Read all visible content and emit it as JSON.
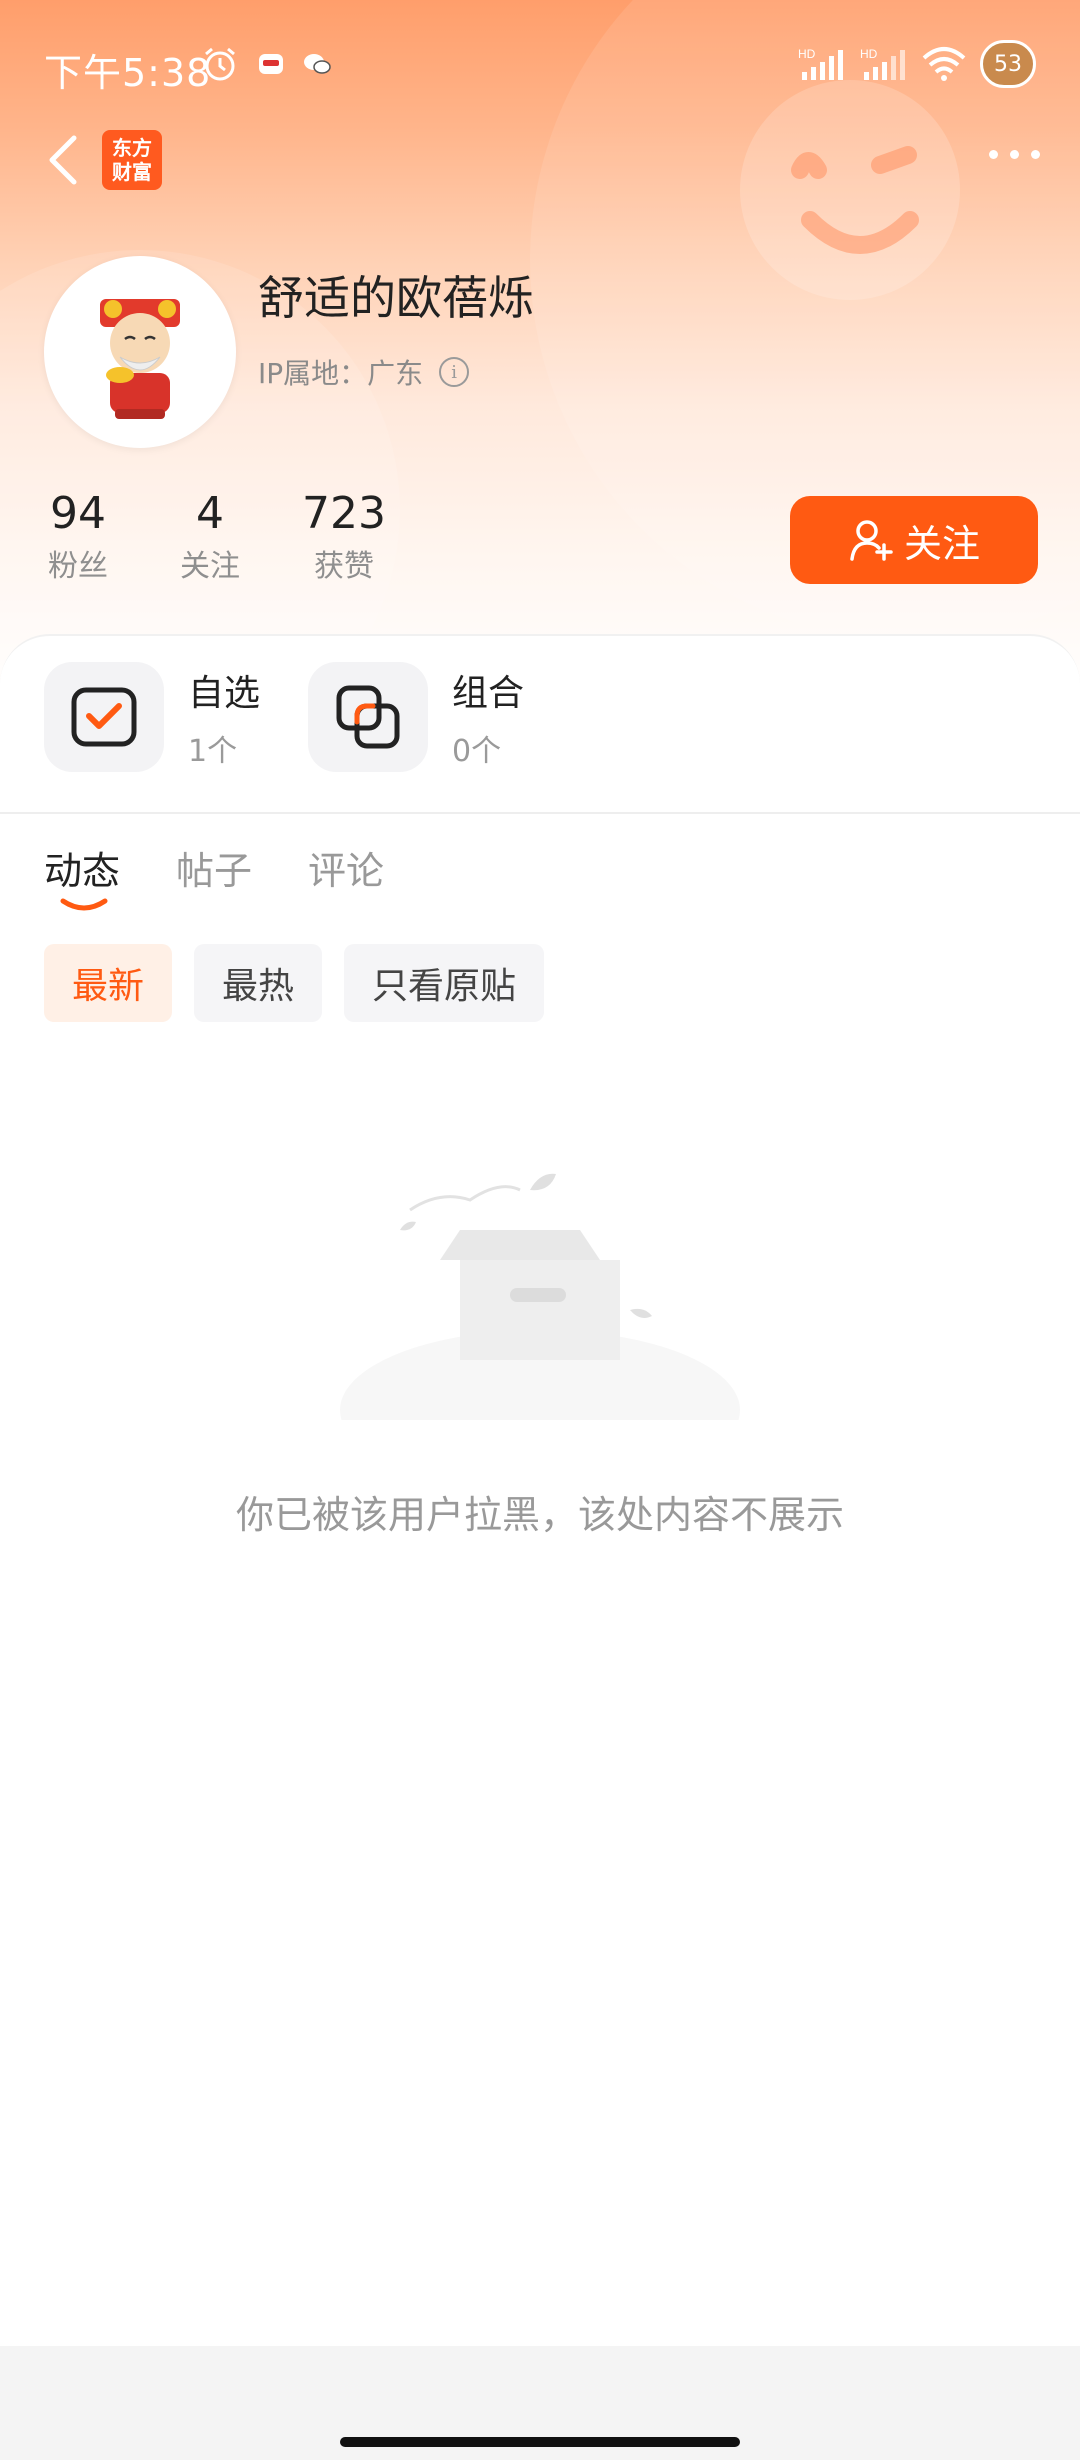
{
  "status_bar": {
    "time": "下午5:38",
    "battery": "53",
    "icons_left": [
      "alarm-icon",
      "app-notification-icon",
      "chat-notification-icon"
    ],
    "icons_right": [
      "hd-signal-icon",
      "hd-signal-icon",
      "wifi-icon",
      "battery-icon"
    ]
  },
  "nav": {
    "brand_line1": "东方",
    "brand_line2": "财富"
  },
  "profile": {
    "username": "舒适的欧蓓烁",
    "ip_label": "IP属地：广东",
    "stats": [
      {
        "value": "94",
        "label": "粉丝"
      },
      {
        "value": "4",
        "label": "关注"
      },
      {
        "value": "723",
        "label": "获赞"
      }
    ],
    "follow_label": "关注"
  },
  "features": [
    {
      "title": "自选",
      "count": "1个",
      "icon": "checkbox-icon"
    },
    {
      "title": "组合",
      "count": "0个",
      "icon": "combination-icon"
    }
  ],
  "tabs": [
    "动态",
    "帖子",
    "评论"
  ],
  "filters": [
    "最新",
    "最热",
    "只看原贴"
  ],
  "empty_message": "你已被该用户拉黑，该处内容不展示",
  "colors": {
    "accent": "#ff5a12",
    "header_gradient_top": "#ff9e6b"
  }
}
